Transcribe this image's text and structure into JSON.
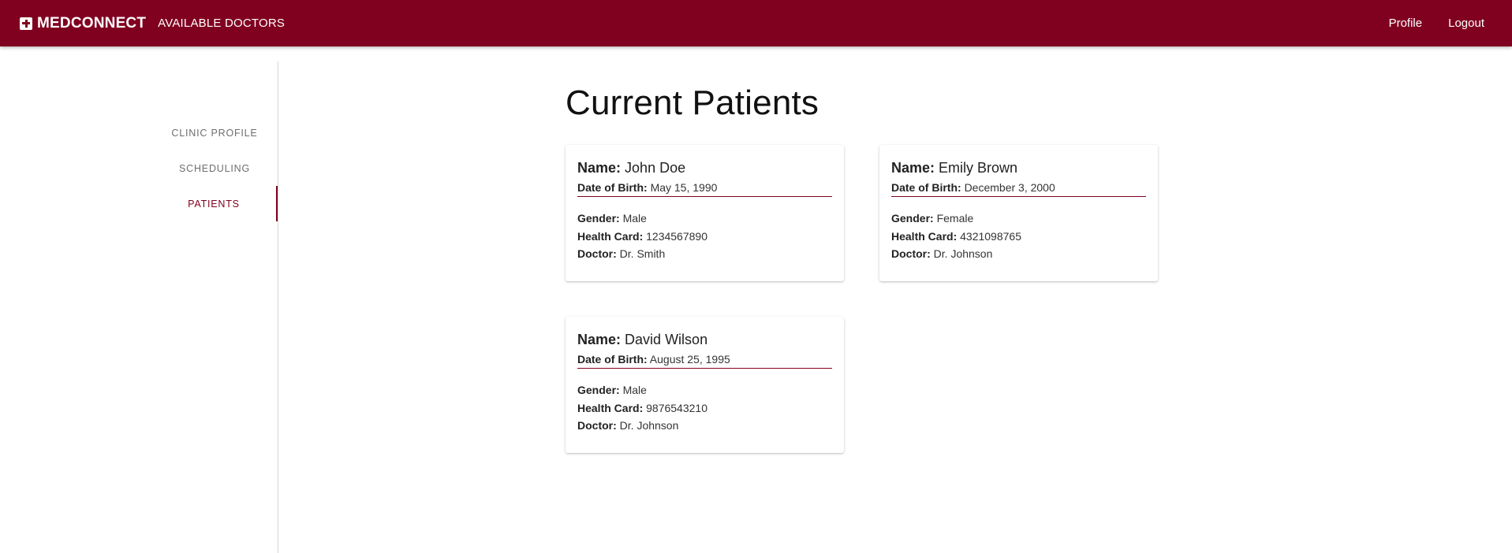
{
  "header": {
    "brand": "MEDCONNECT",
    "nav_link": "AVAILABLE DOCTORS",
    "profile": "Profile",
    "logout": "Logout",
    "color": "#800020"
  },
  "sidebar": {
    "items": [
      {
        "label": "CLINIC PROFILE",
        "active": false
      },
      {
        "label": "SCHEDULING",
        "active": false
      },
      {
        "label": "PATIENTS",
        "active": true
      }
    ]
  },
  "main": {
    "title": "Current Patients",
    "field_labels": {
      "name": "Name:",
      "dob": "Date of Birth:",
      "gender": "Gender:",
      "health_card": "Health Card:",
      "doctor": "Doctor:"
    },
    "patients": [
      {
        "name": "John Doe",
        "dob": "May 15, 1990",
        "gender": "Male",
        "health_card": "1234567890",
        "doctor": "Dr. Smith"
      },
      {
        "name": "Emily Brown",
        "dob": "December 3, 2000",
        "gender": "Female",
        "health_card": "4321098765",
        "doctor": "Dr. Johnson"
      },
      {
        "name": "David Wilson",
        "dob": "August 25, 1995",
        "gender": "Male",
        "health_card": "9876543210",
        "doctor": "Dr. Johnson"
      }
    ]
  }
}
